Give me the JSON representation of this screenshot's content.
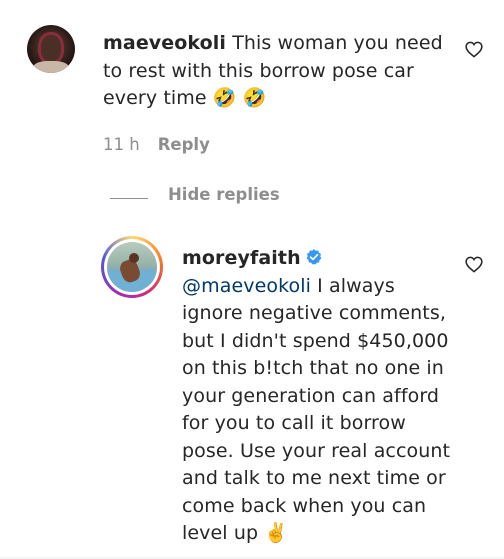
{
  "comment_1": {
    "username": "maeveokoli",
    "text_line_1": "This woman you need",
    "text_line_2": "to rest with this borrow pose car",
    "text_line_3": "every time",
    "emojis": "🤣 🤣",
    "time": "11 h",
    "reply_label": "Reply"
  },
  "replies": {
    "hide_label": "Hide replies"
  },
  "reply_1": {
    "username": "moreyfaith",
    "mention": "@maeveokoli",
    "lines": [
      " I always",
      "ignore negative comments,",
      "but I didn't spend $450,000",
      "on this b!tch that no one in",
      "your generation can afford",
      "for you to call it borrow",
      "pose. Use your real account",
      "and talk to me next time or",
      "come back when you can",
      "level up"
    ],
    "emoji": "✌️"
  },
  "icons": {
    "heart": "heart-outline-icon",
    "verified": "verified-badge-icon",
    "verified_color": "#3897f0"
  }
}
